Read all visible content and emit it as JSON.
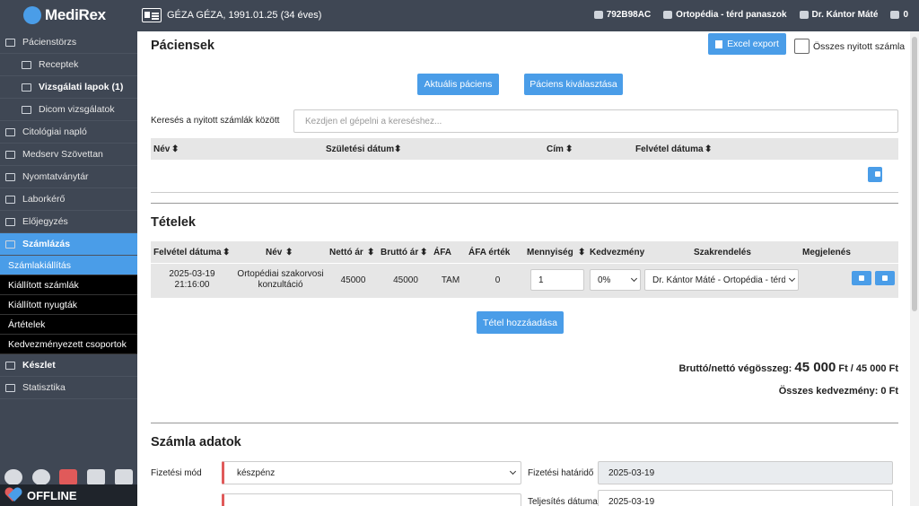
{
  "app": {
    "logo": "MediRex"
  },
  "topbar": {
    "patient": "GÉZA GÉZA, 1991.01.25 (34 éves)",
    "code": "792B98AC",
    "department": "Ortopédia - térd panaszok",
    "doctor": "Dr. Kántor Máté",
    "notifications": "0"
  },
  "sidebar": {
    "items": [
      {
        "label": "Pácienstörzs",
        "level": 1
      },
      {
        "label": "Receptek",
        "level": 2
      },
      {
        "label": "Vizsgálati lapok (1)",
        "level": 2,
        "bold": true
      },
      {
        "label": "Dicom vizsgálatok",
        "level": 2
      },
      {
        "label": "Citológiai napló",
        "level": 1
      },
      {
        "label": "Medserv Szövettan",
        "level": 1
      },
      {
        "label": "Nyomtatványtár",
        "level": 1
      },
      {
        "label": "Laborkérő",
        "level": 1
      },
      {
        "label": "Előjegyzés",
        "level": 1
      },
      {
        "label": "Számlázás",
        "level": 1,
        "active": true
      }
    ],
    "subitems": [
      {
        "label": "Számlakiállítás",
        "active": true
      },
      {
        "label": "Kiállított számlák"
      },
      {
        "label": "Kiállított nyugták"
      },
      {
        "label": "Ártételek"
      },
      {
        "label": "Kedvezményezett csoportok"
      }
    ],
    "items2": [
      {
        "label": "Készlet"
      },
      {
        "label": "Statisztika"
      }
    ],
    "status": "OFFLINE"
  },
  "patients": {
    "title": "Páciensek",
    "excel_export": "Excel export",
    "all_open_label": "Összes nyitott számla",
    "current_patient": "Aktuális páciens",
    "select_patient": "Páciens kiválasztása",
    "search_label": "Keresés a nyitott számlák között",
    "search_placeholder": "Kezdjen el gépelni a kereséshez...",
    "columns": [
      "Név",
      "Születési dátum",
      "Cím",
      "Felvétel dátuma"
    ]
  },
  "items": {
    "title": "Tételek",
    "columns": [
      "Felvétel dátuma",
      "Név",
      "Nettó ár",
      "Bruttó ár",
      "ÁFA",
      "ÁFA érték",
      "Mennyiség",
      "Kedvezmény",
      "Szakrendelés",
      "Megjelenés"
    ],
    "row": {
      "date_line1": "2025-03-19",
      "date_line2": "21:16:00",
      "name_line1": "Ortopédiai szakorvosi",
      "name_line2": "konzultáció",
      "net": "45000",
      "gross": "45000",
      "vat": "TAM",
      "vat_value": "0",
      "quantity": "1",
      "discount": "0%",
      "specialty": "Dr. Kántor Máté - Ortopédia - térd"
    },
    "add_item": "Tétel hozzáadása",
    "total_label": "Bruttó/nettó végösszeg:",
    "total_gross": "45 000",
    "total_rest": "Ft / 45 000 Ft",
    "discount_total": "Összes kedvezmény: 0 Ft"
  },
  "invoice": {
    "title": "Számla adatok",
    "payment_method_label": "Fizetési mód",
    "payment_method": "készpénz",
    "due_label": "Fizetési határidő",
    "due_date": "2025-03-19",
    "fulfilment_label": "Teljesítés dátuma",
    "fulfilment_date": "2025-03-19"
  }
}
